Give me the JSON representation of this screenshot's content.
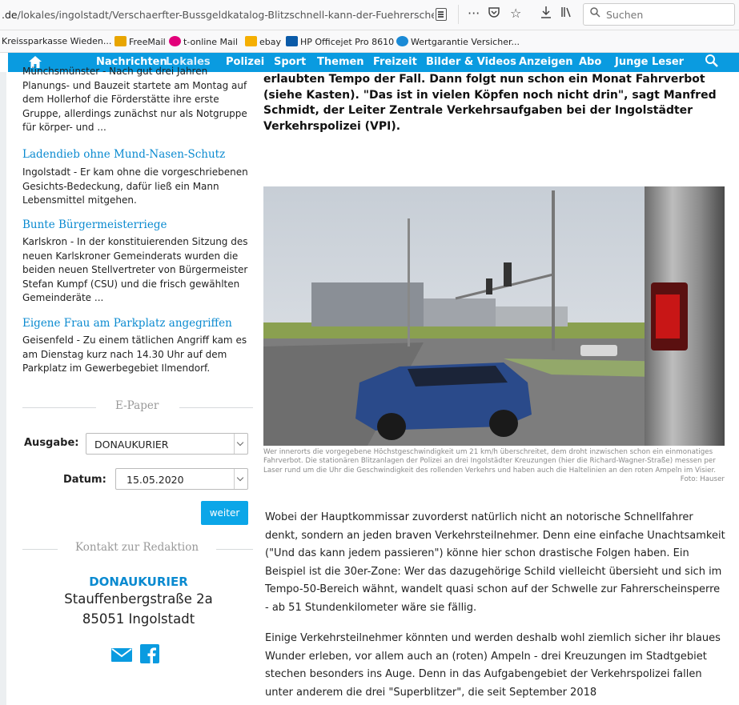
{
  "browser": {
    "url_host": ".de",
    "url_path": "/lokales/ingolstadt/Verschaerfter-Bussgeldkatalog-Blitzschnell-kann-der-Fuehrerschein-we",
    "search_placeholder": "Suchen",
    "bookmarks": [
      "Kreissparkasse Wieden...",
      "FreeMail",
      "t-online Mail",
      "ebay",
      "HP Officejet Pro 8610",
      "Wertgarantie Versicher..."
    ]
  },
  "nav": {
    "items": [
      "Nachrichten",
      "Lokales",
      "Polizei",
      "Sport",
      "Themen",
      "Freizeit",
      "Bilder & Videos",
      "Anzeigen",
      "Abo",
      "Junge Leser"
    ],
    "active": "Lokales"
  },
  "sidebar": {
    "cut_text": "Münchsmünster - Nach gut drei Jahren Planungs- und Bauzeit startete am Montag auf dem Hollerhof die Förderstätte ihre erste Gruppe, allerdings zunächst nur als Notgruppe für körper- und ...",
    "articles": [
      {
        "title": "Ladendieb ohne Mund-Nasen-Schutz",
        "text": "Ingolstadt - Er kam ohne die vorgeschriebenen Gesichts-Bedeckung, dafür ließ ein Mann Lebensmittel mitgehen."
      },
      {
        "title": "Bunte Bürgermeisterriege",
        "text": "Karlskron - In der konstituierenden Sitzung des neuen Karlskroner Gemeinderats wurden die beiden neuen Stellvertreter von Bürgermeister Stefan Kumpf (CSU) und die frisch gewählten Gemeinderäte ..."
      },
      {
        "title": "Eigene Frau am Parkplatz angegriffen",
        "text": "Geisenfeld - Zu einem tätlichen Angriff kam es am Dienstag kurz nach 14.30 Uhr auf dem Parkplatz im Gewerbegebiet Ilmendorf."
      }
    ]
  },
  "epaper": {
    "heading": "E-Paper",
    "ausgabe_label": "Ausgabe:",
    "ausgabe_value": "DONAUKURIER",
    "datum_label": "Datum:",
    "datum_value": "15.05.2020",
    "button": "weiter"
  },
  "contact": {
    "heading": "Kontakt zur Redaktion",
    "name": "DONAUKURIER",
    "street": "Stauffenbergstraße 2a",
    "city": "85051 Ingolstadt"
  },
  "article": {
    "lead": "erlaubten Tempo der Fall. Dann folgt nun schon ein Monat Fahrverbot (siehe Kasten). \"Das ist in vielen Köpfen noch nicht drin\", sagt Manfred Schmidt, der Leiter Zentrale Verkehrsaufgaben bei der Ingolstädter Verkehrspolizei (VPI).",
    "caption": "Wer innerorts die vorgegebene Höchstgeschwindigkeit um 21 km/h überschreitet, dem droht inzwischen schon ein einmonatiges Fahrverbot. Die stationären Blitzanlagen der Polizei an drei Ingolstädter Kreuzungen (hier die Richard-Wagner-Straße) messen per Laser rund um die Uhr die Geschwindigkeit des rollenden Verkehrs und haben auch die Haltelinien an den roten Ampeln im Visier.",
    "credit": "Foto: Hauser",
    "p1": "Wobei der Hauptkommissar zuvorderst natürlich nicht an notorische Schnellfahrer denkt, sondern an jeden braven Verkehrsteilnehmer. Denn eine einfache Unachtsamkeit (\"Und das kann jedem passieren\") könne hier schon drastische Folgen haben. Ein Beispiel ist die 30er-Zone: Wer das dazugehörige Schild vielleicht übersieht und sich im Tempo-50-Bereich wähnt, wandelt quasi schon auf der Schwelle zur Fahrerscheinsperre - ab 51 Stundenkilometer wäre sie fällig.",
    "p2": "Einige Verkehrsteilnehmer könnten und werden deshalb wohl ziemlich sicher ihr blaues Wunder erleben, vor allem auch an (roten) Ampeln - drei Kreuzungen im Stadtgebiet stechen besonders ins Auge. Denn in das Aufgabengebiet der Verkehrspolizei fallen unter anderem die drei \"Superblitzer\", die seit September 2018"
  },
  "colors": {
    "accent": "#0a9be0",
    "link": "#0a8ad0"
  }
}
